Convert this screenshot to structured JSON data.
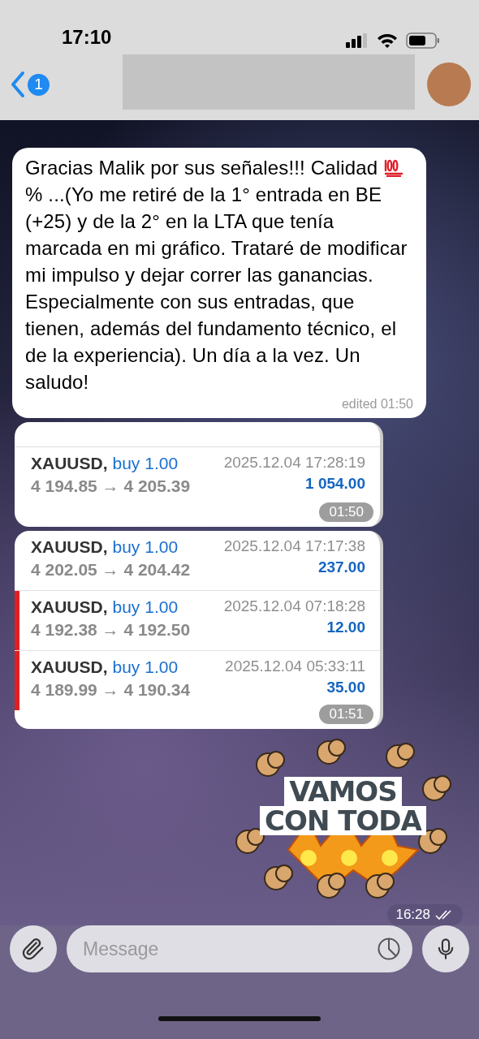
{
  "status_bar": {
    "time": "17:10"
  },
  "header": {
    "unread_count": "1"
  },
  "messages": [
    {
      "kind": "text",
      "text_before_emoji": "Gracias Malik por sus señales!!! Calidad",
      "text_after_emoji": "% ...(Yo me retiré de la 1° entrada en BE (+25) y de la 2° en la LTA que tenía marcada en mi gráfico. Trataré de modificar mi impulso y dejar correr las ganancias. Especialmente con sus entradas, que tienen, además del fundamento técnico, el de la experiencia). Un día a la vez. Un saludo!",
      "edited_label": "edited 01:50"
    },
    {
      "kind": "trades",
      "time": "01:50",
      "partial_top_row": true,
      "rows": [
        {
          "symbol": "XAUUSD,",
          "side": "buy 1.00",
          "date": "2025.12.04 17:28:19",
          "prices": "4 194.85 → 4 205.39",
          "profit": "1 054.00",
          "flagged": false
        }
      ]
    },
    {
      "kind": "trades",
      "time": "01:51",
      "partial_top_row": false,
      "rows": [
        {
          "symbol": "XAUUSD,",
          "side": "buy 1.00",
          "date": "2025.12.04 17:17:38",
          "prices": "4 202.05 → 4 204.42",
          "profit": "237.00",
          "flagged": false
        },
        {
          "symbol": "XAUUSD,",
          "side": "buy 1.00",
          "date": "2025.12.04 07:18:28",
          "prices": "4 192.38 → 4 192.50",
          "profit": "12.00",
          "flagged": true
        },
        {
          "symbol": "XAUUSD,",
          "side": "buy 1.00",
          "date": "2025.12.04 05:33:11",
          "prices": "4 189.99 → 4 190.34",
          "profit": "35.00",
          "flagged": true
        }
      ]
    },
    {
      "kind": "sticker",
      "lines": [
        "VAMOS",
        "CON TODA"
      ],
      "time": "16:28",
      "read": true
    }
  ],
  "composer": {
    "placeholder": "Message"
  }
}
